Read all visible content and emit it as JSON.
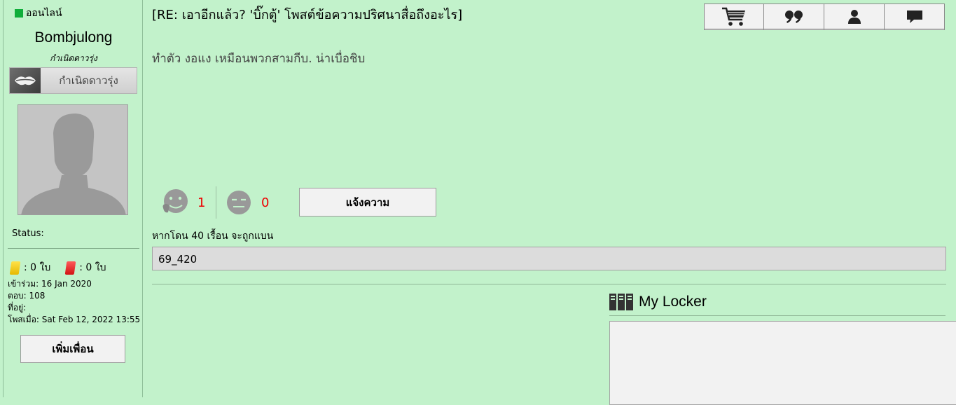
{
  "sidebar": {
    "online_label": "ออนไลน์",
    "username": "Bombjulong",
    "rank_italic": "กำเนิดดาวรุ่ง",
    "rank_badge": "กำเนิดดาวรุ่ง",
    "status_label": "Status:",
    "yellow_cards": ": 0 ใบ",
    "red_cards": ": 0 ใบ",
    "joined": "เข้าร่วม: 16 Jan 2020",
    "replies": "ตอบ: 108",
    "location": "ที่อยู่:",
    "posted_at": "โพสเมื่อ: Sat Feb 12, 2022 13:55",
    "add_friend_label": "เพิ่มเพื่อน"
  },
  "post": {
    "title": "[RE: เอาอีกแล้ว? 'บิ๊กตู้' โพสต์ข้อความปริศนาสื่อถึงอะไร]",
    "body": "ทำตัว งอแง เหมือนพวกสามกีบ. น่าเบื่อชิบ",
    "like_count": "1",
    "dislike_count": "0",
    "report_label": "แจ้งความ",
    "warning_text": "หากโดน 40 เรื้อน จะถูกแบน",
    "signature": "69_420"
  },
  "toolbar": {
    "icons": [
      "cart-icon",
      "quote-icon",
      "user-icon",
      "message-icon"
    ]
  },
  "locker": {
    "title": "My Locker"
  },
  "colors": {
    "background": "#c2f2cb",
    "online": "#0fae3a",
    "count": "#ee0000"
  }
}
